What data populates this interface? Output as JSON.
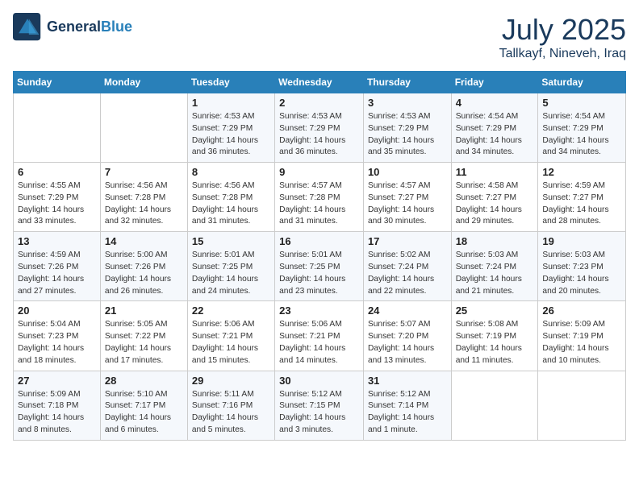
{
  "header": {
    "logo_line1": "General",
    "logo_line2": "Blue",
    "month": "July 2025",
    "location": "Tallkayf, Nineveh, Iraq"
  },
  "weekdays": [
    "Sunday",
    "Monday",
    "Tuesday",
    "Wednesday",
    "Thursday",
    "Friday",
    "Saturday"
  ],
  "weeks": [
    [
      {
        "day": "",
        "info": ""
      },
      {
        "day": "",
        "info": ""
      },
      {
        "day": "1",
        "info": "Sunrise: 4:53 AM\nSunset: 7:29 PM\nDaylight: 14 hours and 36 minutes."
      },
      {
        "day": "2",
        "info": "Sunrise: 4:53 AM\nSunset: 7:29 PM\nDaylight: 14 hours and 36 minutes."
      },
      {
        "day": "3",
        "info": "Sunrise: 4:53 AM\nSunset: 7:29 PM\nDaylight: 14 hours and 35 minutes."
      },
      {
        "day": "4",
        "info": "Sunrise: 4:54 AM\nSunset: 7:29 PM\nDaylight: 14 hours and 34 minutes."
      },
      {
        "day": "5",
        "info": "Sunrise: 4:54 AM\nSunset: 7:29 PM\nDaylight: 14 hours and 34 minutes."
      }
    ],
    [
      {
        "day": "6",
        "info": "Sunrise: 4:55 AM\nSunset: 7:29 PM\nDaylight: 14 hours and 33 minutes."
      },
      {
        "day": "7",
        "info": "Sunrise: 4:56 AM\nSunset: 7:28 PM\nDaylight: 14 hours and 32 minutes."
      },
      {
        "day": "8",
        "info": "Sunrise: 4:56 AM\nSunset: 7:28 PM\nDaylight: 14 hours and 31 minutes."
      },
      {
        "day": "9",
        "info": "Sunrise: 4:57 AM\nSunset: 7:28 PM\nDaylight: 14 hours and 31 minutes."
      },
      {
        "day": "10",
        "info": "Sunrise: 4:57 AM\nSunset: 7:27 PM\nDaylight: 14 hours and 30 minutes."
      },
      {
        "day": "11",
        "info": "Sunrise: 4:58 AM\nSunset: 7:27 PM\nDaylight: 14 hours and 29 minutes."
      },
      {
        "day": "12",
        "info": "Sunrise: 4:59 AM\nSunset: 7:27 PM\nDaylight: 14 hours and 28 minutes."
      }
    ],
    [
      {
        "day": "13",
        "info": "Sunrise: 4:59 AM\nSunset: 7:26 PM\nDaylight: 14 hours and 27 minutes."
      },
      {
        "day": "14",
        "info": "Sunrise: 5:00 AM\nSunset: 7:26 PM\nDaylight: 14 hours and 26 minutes."
      },
      {
        "day": "15",
        "info": "Sunrise: 5:01 AM\nSunset: 7:25 PM\nDaylight: 14 hours and 24 minutes."
      },
      {
        "day": "16",
        "info": "Sunrise: 5:01 AM\nSunset: 7:25 PM\nDaylight: 14 hours and 23 minutes."
      },
      {
        "day": "17",
        "info": "Sunrise: 5:02 AM\nSunset: 7:24 PM\nDaylight: 14 hours and 22 minutes."
      },
      {
        "day": "18",
        "info": "Sunrise: 5:03 AM\nSunset: 7:24 PM\nDaylight: 14 hours and 21 minutes."
      },
      {
        "day": "19",
        "info": "Sunrise: 5:03 AM\nSunset: 7:23 PM\nDaylight: 14 hours and 20 minutes."
      }
    ],
    [
      {
        "day": "20",
        "info": "Sunrise: 5:04 AM\nSunset: 7:23 PM\nDaylight: 14 hours and 18 minutes."
      },
      {
        "day": "21",
        "info": "Sunrise: 5:05 AM\nSunset: 7:22 PM\nDaylight: 14 hours and 17 minutes."
      },
      {
        "day": "22",
        "info": "Sunrise: 5:06 AM\nSunset: 7:21 PM\nDaylight: 14 hours and 15 minutes."
      },
      {
        "day": "23",
        "info": "Sunrise: 5:06 AM\nSunset: 7:21 PM\nDaylight: 14 hours and 14 minutes."
      },
      {
        "day": "24",
        "info": "Sunrise: 5:07 AM\nSunset: 7:20 PM\nDaylight: 14 hours and 13 minutes."
      },
      {
        "day": "25",
        "info": "Sunrise: 5:08 AM\nSunset: 7:19 PM\nDaylight: 14 hours and 11 minutes."
      },
      {
        "day": "26",
        "info": "Sunrise: 5:09 AM\nSunset: 7:19 PM\nDaylight: 14 hours and 10 minutes."
      }
    ],
    [
      {
        "day": "27",
        "info": "Sunrise: 5:09 AM\nSunset: 7:18 PM\nDaylight: 14 hours and 8 minutes."
      },
      {
        "day": "28",
        "info": "Sunrise: 5:10 AM\nSunset: 7:17 PM\nDaylight: 14 hours and 6 minutes."
      },
      {
        "day": "29",
        "info": "Sunrise: 5:11 AM\nSunset: 7:16 PM\nDaylight: 14 hours and 5 minutes."
      },
      {
        "day": "30",
        "info": "Sunrise: 5:12 AM\nSunset: 7:15 PM\nDaylight: 14 hours and 3 minutes."
      },
      {
        "day": "31",
        "info": "Sunrise: 5:12 AM\nSunset: 7:14 PM\nDaylight: 14 hours and 1 minute."
      },
      {
        "day": "",
        "info": ""
      },
      {
        "day": "",
        "info": ""
      }
    ]
  ]
}
